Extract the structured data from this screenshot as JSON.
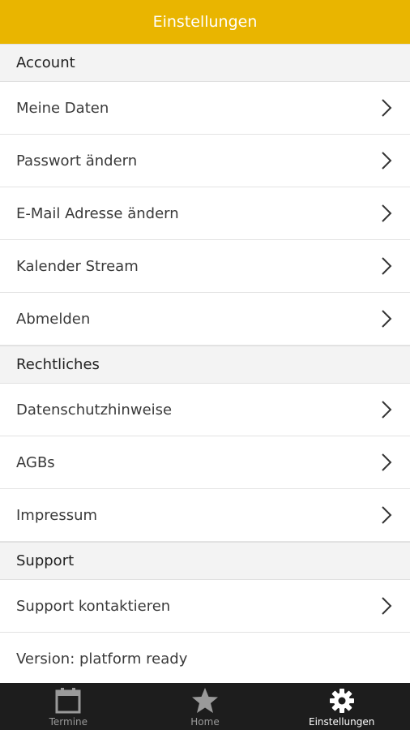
{
  "header": {
    "title": "Einstellungen"
  },
  "sections": [
    {
      "title": "Account",
      "items": [
        "Meine Daten",
        "Passwort ändern",
        "E-Mail Adresse ändern",
        "Kalender Stream",
        "Abmelden"
      ]
    },
    {
      "title": "Rechtliches",
      "items": [
        "Datenschutzhinweise",
        "AGBs",
        "Impressum"
      ]
    },
    {
      "title": "Support",
      "items": [
        "Support kontaktieren"
      ],
      "version": "Version: platform ready"
    }
  ],
  "tabbar": {
    "tabs": [
      {
        "label": "Termine",
        "icon": "calendar-icon"
      },
      {
        "label": "Home",
        "icon": "star-icon"
      },
      {
        "label": "Einstellungen",
        "icon": "gear-icon",
        "active": true
      }
    ]
  },
  "colors": {
    "header_bg": "#e9b500",
    "tabbar_bg": "#1d1d1d",
    "section_bg": "#f3f3f3"
  }
}
